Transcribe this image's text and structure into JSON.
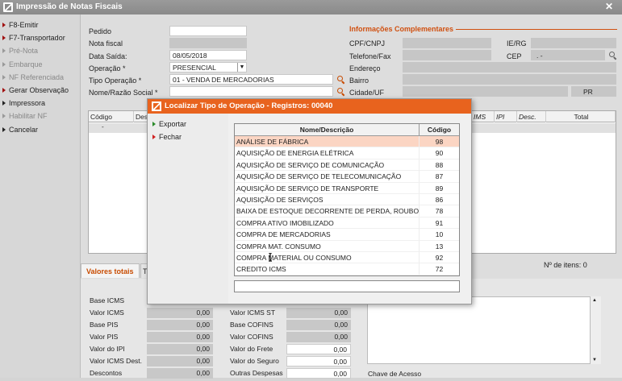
{
  "window": {
    "title": "Impressão de Notas Fiscais",
    "close": "✕"
  },
  "sidebar": {
    "items": [
      {
        "label": "F8-Emitir",
        "state": "active"
      },
      {
        "label": "F7-Transportador",
        "state": "active"
      },
      {
        "label": "Pré-Nota",
        "state": "disabled"
      },
      {
        "label": "Embarque",
        "state": "disabled"
      },
      {
        "label": "NF Referenciada",
        "state": "disabled"
      },
      {
        "label": "Gerar Observação",
        "state": "active"
      },
      {
        "label": "Impressora",
        "state": "context"
      },
      {
        "label": "Habilitar NF",
        "state": "disabled"
      },
      {
        "label": "Cancelar",
        "state": "context"
      }
    ]
  },
  "form": {
    "pedido_label": "Pedido",
    "pedido_value": "",
    "nota_label": "Nota fiscal",
    "nota_value": "",
    "data_label": "Data Saída:",
    "data_value": "08/05/2018",
    "operacao_label": "Operação *",
    "operacao_value": "PRESENCIAL",
    "tipo_label": "Tipo Operação *",
    "tipo_value": "01 - VENDA DE MERCADORIAS",
    "nome_label": "Nome/Razão Social *",
    "nome_value": ""
  },
  "info": {
    "section_title": "Informações Complementares",
    "cpf_label": "CPF/CNPJ",
    "ie_label": "IE/RG",
    "telefone_label": "Telefone/Fax",
    "cep_label": "CEP",
    "cep_value": ". -",
    "endereco_label": "Endereço",
    "bairro_label": "Bairro",
    "cidade_label": "Cidade/UF",
    "uf_value": "PR"
  },
  "items_grid": {
    "columns": [
      "Código",
      "Desc",
      "IMS",
      "IPI",
      "Desc.",
      "Total"
    ],
    "row_marker": "-",
    "count_label": "Nº de itens: 0"
  },
  "tabs": {
    "valores_totais": "Valores totais",
    "second": "T"
  },
  "totals": {
    "left": [
      {
        "label": "Base ICMS",
        "value": ""
      },
      {
        "label": "Valor ICMS",
        "value": "0,00"
      },
      {
        "label": "Base PIS",
        "value": "0,00"
      },
      {
        "label": "Valor PIS",
        "value": "0,00"
      },
      {
        "label": "Valor do IPI",
        "value": "0,00"
      },
      {
        "label": "Valor ICMS Dest.",
        "value": "0,00"
      },
      {
        "label": "Descontos",
        "value": "0,00"
      }
    ],
    "right": [
      {
        "label": "Valor ICMS ST",
        "value": "0,00"
      },
      {
        "label": "Base COFINS",
        "value": "0,00"
      },
      {
        "label": "Valor COFINS",
        "value": "0,00"
      },
      {
        "label": "Valor do Frete",
        "value": "0,00"
      },
      {
        "label": "Valor do Seguro",
        "value": "0,00"
      },
      {
        "label": "Outras Despesas",
        "value": "0,00"
      }
    ],
    "chave_label": "Chave de Acesso"
  },
  "modal": {
    "title": "Localizar Tipo de Operação - Registros: 00040",
    "actions": {
      "exportar": "Exportar",
      "fechar": "Fechar"
    },
    "headers": {
      "nome": "Nome/Descrição",
      "codigo": "Código"
    },
    "rows": [
      {
        "nome": "ANÁLISE DE FÁBRICA",
        "codigo": "98"
      },
      {
        "nome": "AQUISIÇÃO DE ENERGIA ELÉTRICA",
        "codigo": "90"
      },
      {
        "nome": "AQUISIÇÃO DE SERVIÇO DE COMUNICAÇÃO",
        "codigo": "88"
      },
      {
        "nome": "AQUISIÇÃO DE SERVIÇO DE TELECOMUNICAÇÃO",
        "codigo": "87"
      },
      {
        "nome": "AQUISIÇÃO DE SERVIÇO DE TRANSPORTE",
        "codigo": "89"
      },
      {
        "nome": "AQUISIÇÃO DE SERVIÇOS",
        "codigo": "86"
      },
      {
        "nome": "BAIXA DE ESTOQUE DECORRENTE DE PERDA, ROUBO OU",
        "codigo": "78"
      },
      {
        "nome": "COMPRA ATIVO IMOBILIZADO",
        "codigo": "91"
      },
      {
        "nome": "COMPRA DE MERCADORIAS",
        "codigo": "10"
      },
      {
        "nome": "COMPRA MAT. CONSUMO",
        "codigo": "13"
      },
      {
        "nome": "COMPRA MATERIAL OU CONSUMO",
        "codigo": "92"
      },
      {
        "nome": "CREDITO ICMS",
        "codigo": "72"
      }
    ],
    "filter_value": ""
  },
  "colors": {
    "accent": "#e8631e",
    "selected_row": "#fbd5c3",
    "section": "#d05010"
  }
}
